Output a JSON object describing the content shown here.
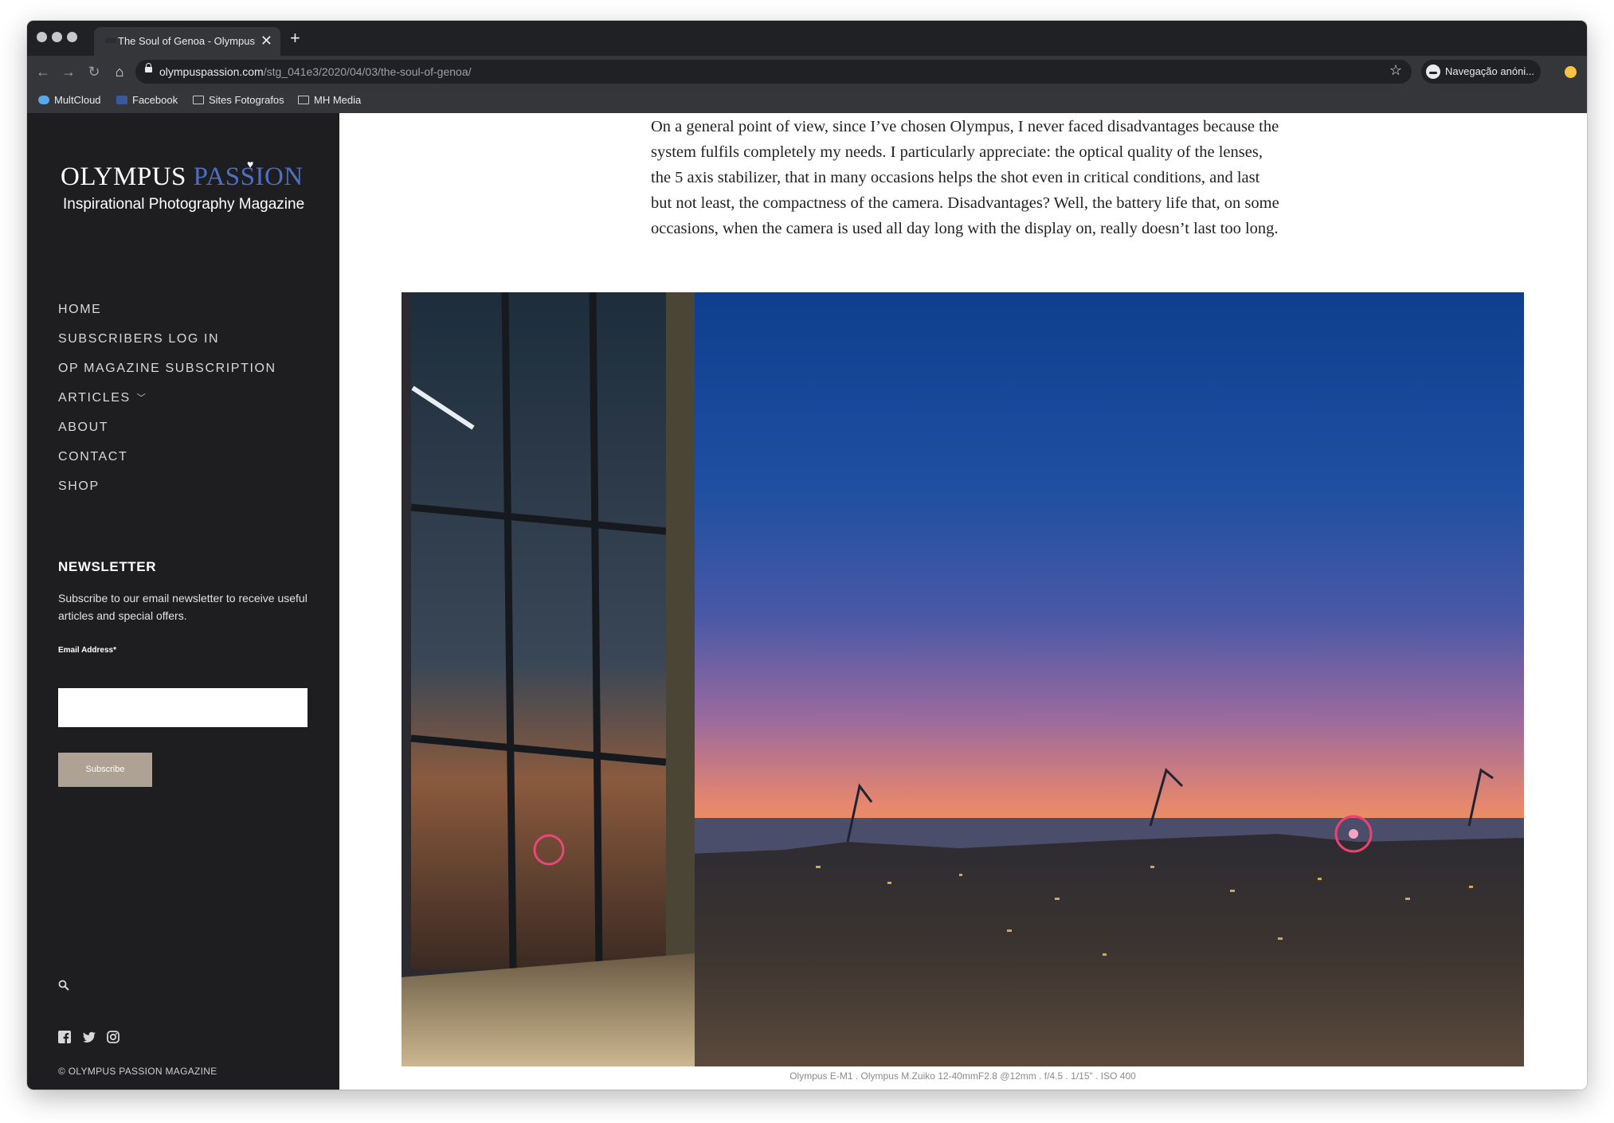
{
  "browser": {
    "tab_title": "The Soul of Genoa - Olympus Passion",
    "tab_close": "✕",
    "new_tab": "+",
    "url_host": "olympuspassion.com",
    "url_path": "/stg_041e3/2020/04/03/the-soul-of-genoa/",
    "profile_label": "Navegação anóni...",
    "bookmarks": [
      "MultCloud",
      "Facebook",
      "Sites Fotografos",
      "MH Media"
    ]
  },
  "sidebar": {
    "logo_main": "OLYMPUS",
    "logo_accent": "PASSION",
    "logo_tagline": "Inspirational Photography Magazine",
    "menu": [
      {
        "label": "HOME"
      },
      {
        "label": "SUBSCRIBERS LOG IN"
      },
      {
        "label": "OP MAGAZINE SUBSCRIPTION"
      },
      {
        "label": "ARTICLES"
      },
      {
        "label": "ABOUT"
      },
      {
        "label": "CONTACT"
      },
      {
        "label": "SHOP"
      }
    ],
    "newsletter": {
      "title": "NEWSLETTER",
      "description": "Subscribe to our email newsletter to receive useful articles and special offers.",
      "email_label": "Email Address*",
      "email_value": "",
      "button": "Subscribe"
    },
    "copyright": "© OLYMPUS PASSION MAGAZINE"
  },
  "article": {
    "paragraph": "On a general point of view, since I’ve chosen Olympus, I never faced disadvantages because the system fulfils completely my needs. I particularly appreciate: the optical quality of the lenses, the 5 axis stabilizer, that in many occasions helps the shot even in critical conditions, and last but not least, the compactness of the camera. Disadvantages? Well, the battery life that, on some occasions, when the camera is used all day long with the display on, really doesn’t last too long.",
    "photo_caption": "Olympus E-M1 . Olympus M.Zuiko 12-40mmF2.8 @12mm . f/4.5 . 1/15\" . ISO 400"
  },
  "colors": {
    "sidebar_bg": "#1e1e21",
    "logo_accent": "#4d6fc4",
    "subscribe_button": "#aea295",
    "chrome_dark": "#202124",
    "chrome_toolbar": "#35363a"
  },
  "icons": [
    "back-arrow-icon",
    "forward-arrow-icon",
    "reload-icon",
    "home-icon",
    "lock-icon",
    "star-icon",
    "incognito-icon",
    "search-icon",
    "facebook-icon",
    "twitter-icon",
    "instagram-icon",
    "chevron-down-icon"
  ]
}
